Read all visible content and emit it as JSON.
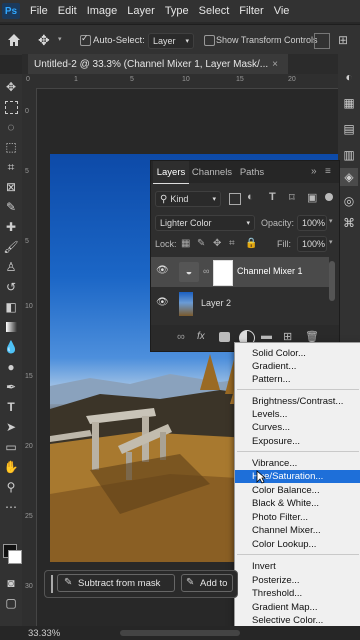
{
  "app": {
    "logo_text": "Ps"
  },
  "menubar": {
    "items": [
      "File",
      "Edit",
      "Image",
      "Layer",
      "Type",
      "Select",
      "Filter",
      "Vie"
    ]
  },
  "options": {
    "auto_select_label": "Auto-Select:",
    "auto_select_checked": true,
    "auto_select_value": "Layer",
    "transform_label": "Show Transform Controls"
  },
  "document": {
    "tab_title": "Untitled-2 @ 33.3% (Channel Mixer 1, Layer Mask/...",
    "zoom": "33.33%"
  },
  "rulers": {
    "h": [
      "0",
      "1",
      "5",
      "10",
      "15",
      "20"
    ],
    "v": [
      "0",
      "5",
      "5",
      "10",
      "15",
      "20",
      "25",
      "30"
    ]
  },
  "layers_panel": {
    "tabs": [
      "Layers",
      "Channels",
      "Paths"
    ],
    "filter_kind": "Kind",
    "blend_mode": "Lighter Color",
    "opacity_label": "Opacity:",
    "opacity_value": "100%",
    "lock_label": "Lock:",
    "fill_label": "Fill:",
    "fill_value": "100%",
    "layers": [
      {
        "name": "Channel Mixer 1",
        "selected": true
      },
      {
        "name": "Layer 2",
        "selected": false
      }
    ]
  },
  "adjustment_menu": {
    "groups": [
      [
        "Solid Color...",
        "Gradient...",
        "Pattern..."
      ],
      [
        "Brightness/Contrast...",
        "Levels...",
        "Curves...",
        "Exposure..."
      ],
      [
        "Vibrance...",
        "Hue/Saturation...",
        "Color Balance...",
        "Black & White...",
        "Photo Filter...",
        "Channel Mixer...",
        "Color Lookup..."
      ],
      [
        "Invert",
        "Posterize...",
        "Threshold...",
        "Gradient Map...",
        "Selective Color..."
      ]
    ],
    "highlighted": "Hue/Saturation..."
  },
  "contextual_bar": {
    "subtract_label": "Subtract from mask",
    "add_label": "Add to"
  },
  "colors": {
    "accent": "#1e6fd9",
    "panel_bg": "#2e2e2e",
    "chrome_bg": "#323232"
  }
}
